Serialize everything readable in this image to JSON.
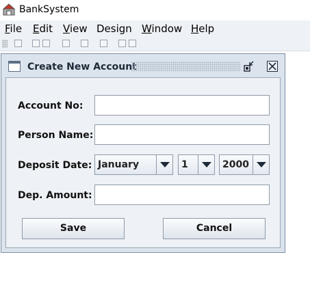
{
  "window": {
    "title": "BankSystem"
  },
  "menu": [
    {
      "mnemonic": "F",
      "rest": "ile"
    },
    {
      "mnemonic": "E",
      "rest": "dit"
    },
    {
      "mnemonic": "V",
      "rest": "iew"
    },
    {
      "mnemonic": "",
      "rest": "Design"
    },
    {
      "mnemonic": "W",
      "rest": "indow"
    },
    {
      "mnemonic": "H",
      "rest": "elp"
    }
  ],
  "internal_frame": {
    "title": "Create New Account"
  },
  "form": {
    "account_no": {
      "label": "Account No:",
      "value": ""
    },
    "person_name": {
      "label": "Person Name:",
      "value": ""
    },
    "deposit_date": {
      "label": "Deposit Date:",
      "month": "January",
      "day": "1",
      "year": "2000"
    },
    "amount": {
      "label": "Dep. Amount:",
      "value": ""
    }
  },
  "buttons": {
    "save": "Save",
    "cancel": "Cancel"
  },
  "icons": {
    "app": "bank-app-icon",
    "frame": "window-frame-icon",
    "iconify": "iconify-icon",
    "close": "close-x-icon",
    "dropdown": "chevron-down-icon"
  }
}
